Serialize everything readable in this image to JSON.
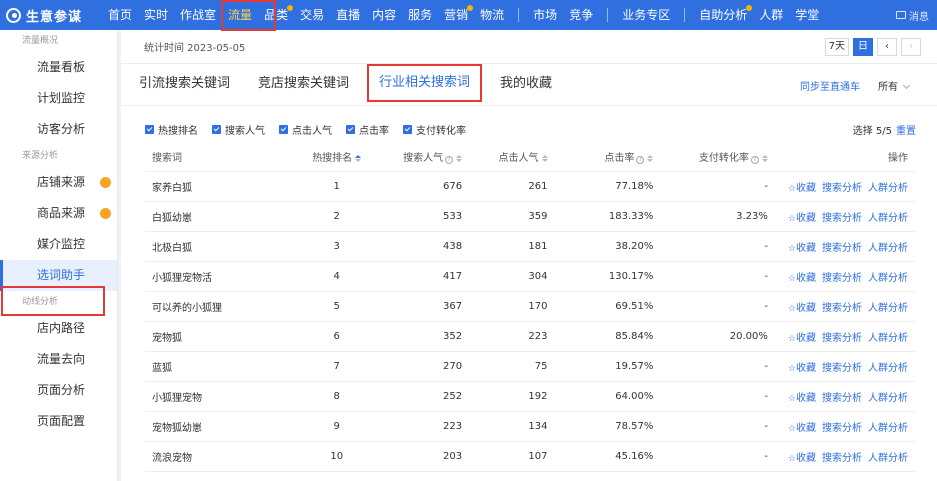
{
  "app": {
    "name": "生意参谋"
  },
  "topnav": {
    "items": [
      {
        "label": "首页",
        "dot": false,
        "active": false
      },
      {
        "label": "实时",
        "dot": false,
        "active": false
      },
      {
        "label": "作战室",
        "dot": false,
        "active": false
      },
      {
        "label": "流量",
        "dot": false,
        "active": true
      },
      {
        "label": "品类",
        "dot": true,
        "active": false
      },
      {
        "label": "交易",
        "dot": false,
        "active": false
      },
      {
        "label": "直播",
        "dot": false,
        "active": false
      },
      {
        "label": "内容",
        "dot": false,
        "active": false
      },
      {
        "label": "服务",
        "dot": false,
        "active": false
      },
      {
        "label": "营销",
        "dot": true,
        "active": false
      },
      {
        "label": "物流",
        "dot": false,
        "active": false
      }
    ],
    "group2": [
      {
        "label": "市场"
      },
      {
        "label": "竞争"
      }
    ],
    "group3": [
      {
        "label": "业务专区"
      }
    ],
    "group4": [
      {
        "label": "自助分析",
        "dot": true
      },
      {
        "label": "人群"
      },
      {
        "label": "学堂"
      }
    ],
    "message_label": "消息"
  },
  "sidebar": {
    "group1": "流量概况",
    "group1_items": [
      {
        "label": "流量看板"
      },
      {
        "label": "计划监控"
      },
      {
        "label": "访客分析"
      }
    ],
    "group2": "来源分析",
    "group2_items": [
      {
        "label": "店铺来源",
        "dot": true
      },
      {
        "label": "商品来源",
        "dot": true
      },
      {
        "label": "媒介监控",
        "dot": false
      },
      {
        "label": "选词助手",
        "dot": false,
        "active": true
      }
    ],
    "group3": "动线分析",
    "group3_items": [
      {
        "label": "店内路径"
      },
      {
        "label": "流量去向"
      },
      {
        "label": "页面分析"
      },
      {
        "label": "页面配置"
      }
    ]
  },
  "datebar": {
    "text": "统计时间 2023-05-05",
    "btn_7d": "7天",
    "btn_day": "日",
    "prev": "‹",
    "next": "›"
  },
  "tabs": {
    "items": [
      {
        "label": "引流搜索关键词"
      },
      {
        "label": "竞店搜索关键词"
      },
      {
        "label": "行业相关搜索词",
        "active": true
      },
      {
        "label": "我的收藏"
      }
    ],
    "sync_label": "同步至直通车",
    "all_label": "所有"
  },
  "filters": {
    "items": [
      {
        "label": "热搜排名"
      },
      {
        "label": "搜索人气"
      },
      {
        "label": "点击人气"
      },
      {
        "label": "点击率"
      },
      {
        "label": "支付转化率"
      }
    ],
    "selected_text": "选择 5/5",
    "reset_label": "重置"
  },
  "table": {
    "headers": {
      "keyword": "搜索词",
      "rank": "热搜排名",
      "popularity": "搜索人气",
      "clicks": "点击人气",
      "ctr": "点击率",
      "conversion": "支付转化率",
      "ops": "操作"
    },
    "ops": {
      "collect": "收藏",
      "search_analysis": "搜索分析",
      "crowd_analysis": "人群分析"
    },
    "rows": [
      {
        "keyword": "家养白狐",
        "rank": "1",
        "popularity": "676",
        "clicks": "261",
        "ctr": "77.18%",
        "conversion": "-"
      },
      {
        "keyword": "白狐幼崽",
        "rank": "2",
        "popularity": "533",
        "clicks": "359",
        "ctr": "183.33%",
        "conversion": "3.23%"
      },
      {
        "keyword": "北极白狐",
        "rank": "3",
        "popularity": "438",
        "clicks": "181",
        "ctr": "38.20%",
        "conversion": "-"
      },
      {
        "keyword": "小狐狸宠物活",
        "rank": "4",
        "popularity": "417",
        "clicks": "304",
        "ctr": "130.17%",
        "conversion": "-"
      },
      {
        "keyword": "可以养的小狐狸",
        "rank": "5",
        "popularity": "367",
        "clicks": "170",
        "ctr": "69.51%",
        "conversion": "-"
      },
      {
        "keyword": "宠物狐",
        "rank": "6",
        "popularity": "352",
        "clicks": "223",
        "ctr": "85.84%",
        "conversion": "20.00%"
      },
      {
        "keyword": "蓝狐",
        "rank": "7",
        "popularity": "270",
        "clicks": "75",
        "ctr": "19.57%",
        "conversion": "-"
      },
      {
        "keyword": "小狐狸宠物",
        "rank": "8",
        "popularity": "252",
        "clicks": "192",
        "ctr": "64.00%",
        "conversion": "-"
      },
      {
        "keyword": "宠物狐幼崽",
        "rank": "9",
        "popularity": "223",
        "clicks": "134",
        "ctr": "78.57%",
        "conversion": "-"
      },
      {
        "keyword": "流浪宠物",
        "rank": "10",
        "popularity": "203",
        "clicks": "107",
        "ctr": "45.16%",
        "conversion": "-"
      }
    ]
  },
  "colors": {
    "brand": "#2f6fe0",
    "highlight": "#e53935",
    "badge": "#f7a325"
  }
}
